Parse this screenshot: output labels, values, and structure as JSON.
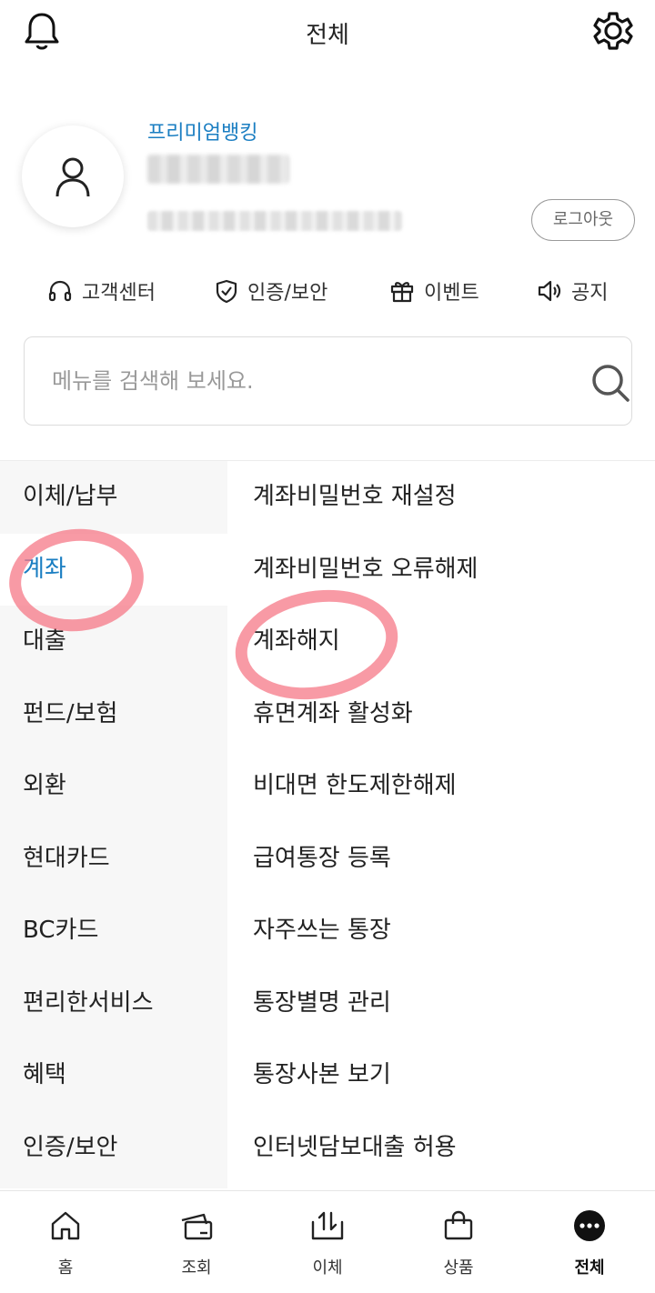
{
  "header": {
    "title": "전체",
    "left_icon": "bell-icon",
    "right_icon": "gear-icon"
  },
  "profile": {
    "premium_label": "프리미엄뱅킹",
    "logout_label": "로그아웃"
  },
  "quick_links": [
    {
      "label": "고객센터",
      "icon": "headset-icon"
    },
    {
      "label": "인증/보안",
      "icon": "shield-check-icon"
    },
    {
      "label": "이벤트",
      "icon": "gift-icon"
    },
    {
      "label": "공지",
      "icon": "speaker-icon"
    }
  ],
  "search": {
    "placeholder": "메뉴를 검색해 보세요."
  },
  "categories": [
    "이체/납부",
    "계좌",
    "대출",
    "펀드/보험",
    "외환",
    "현대카드",
    "BC카드",
    "편리한서비스",
    "혜택",
    "인증/보안"
  ],
  "active_category": "계좌",
  "submenu": [
    "계좌비밀번호 재설정",
    "계좌비밀번호 오류해제",
    "계좌해지",
    "휴면계좌 활성화",
    "비대면 한도제한해제",
    "급여통장 등록",
    "자주쓰는 통장",
    "통장별명 관리",
    "통장사본 보기",
    "인터넷담보대출 허용"
  ],
  "tabbar": [
    {
      "label": "홈",
      "icon": "home-icon"
    },
    {
      "label": "조회",
      "icon": "cards-icon"
    },
    {
      "label": "이체",
      "icon": "transfer-icon"
    },
    {
      "label": "상품",
      "icon": "shopping-bag-icon"
    },
    {
      "label": "전체",
      "icon": "more-icon"
    }
  ],
  "colors": {
    "accent": "#1a7ec2",
    "annotation": "#f5788a"
  }
}
